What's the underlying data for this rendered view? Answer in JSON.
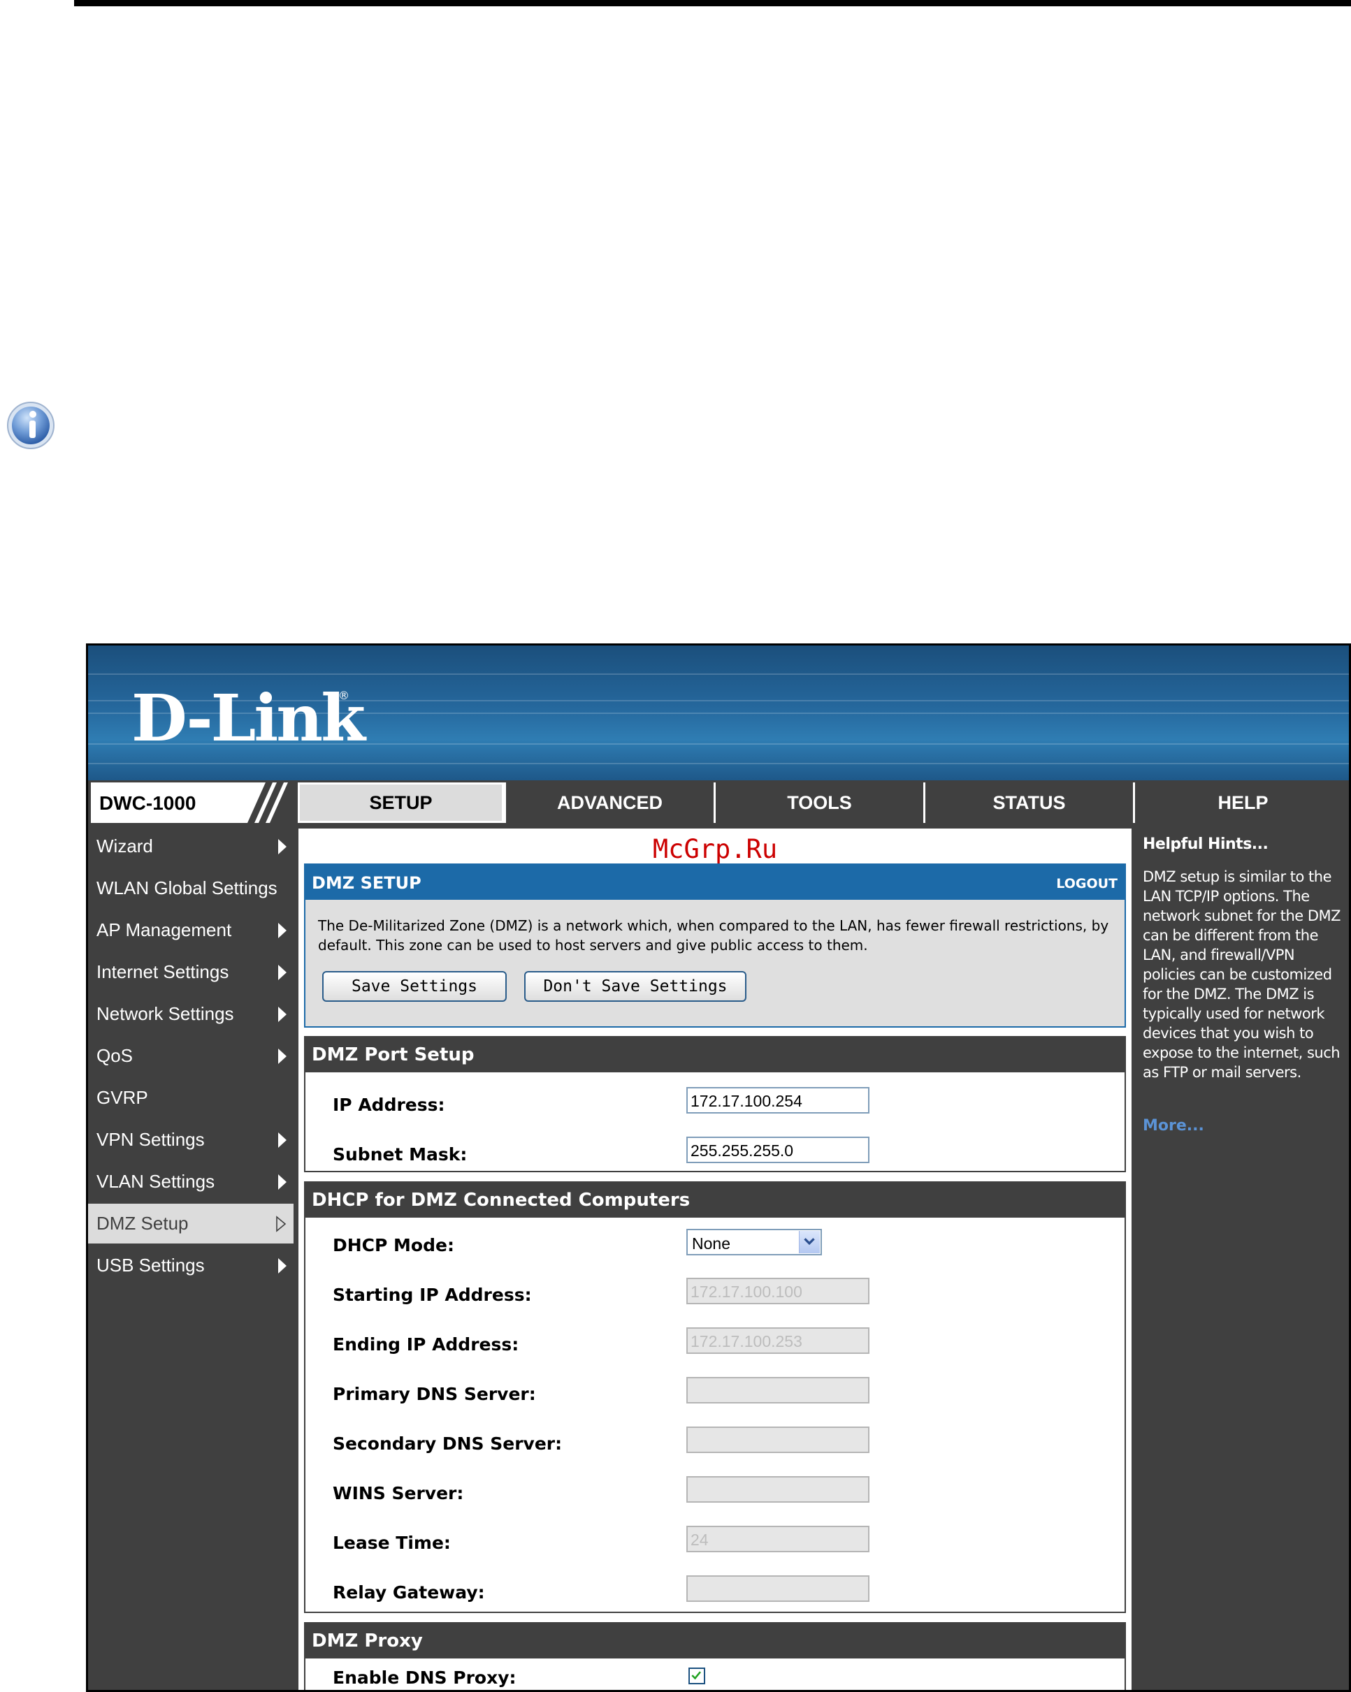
{
  "page": {
    "accent_color": "#1c6aa8",
    "dark_color": "#404040"
  },
  "brand": {
    "logo_text": "D-Link",
    "logo_mark": "®",
    "model": "DWC-1000"
  },
  "tabs": [
    {
      "label": "SETUP",
      "active": true
    },
    {
      "label": "ADVANCED",
      "active": false
    },
    {
      "label": "TOOLS",
      "active": false
    },
    {
      "label": "STATUS",
      "active": false
    },
    {
      "label": "HELP",
      "active": false
    }
  ],
  "sidebar": {
    "items": [
      {
        "label": "Wizard",
        "arrow": "submenu"
      },
      {
        "label": "WLAN Global Settings",
        "arrow": "none"
      },
      {
        "label": "AP Management",
        "arrow": "submenu"
      },
      {
        "label": "Internet Settings",
        "arrow": "submenu"
      },
      {
        "label": "Network Settings",
        "arrow": "submenu"
      },
      {
        "label": "QoS",
        "arrow": "submenu"
      },
      {
        "label": "GVRP",
        "arrow": "none"
      },
      {
        "label": "VPN Settings",
        "arrow": "submenu"
      },
      {
        "label": "VLAN Settings",
        "arrow": "submenu"
      },
      {
        "label": "DMZ Setup",
        "arrow": "active"
      },
      {
        "label": "USB Settings",
        "arrow": "submenu"
      }
    ]
  },
  "watermark": "McGrp.Ru",
  "dmz_setup": {
    "title": "DMZ SETUP",
    "logout": "LOGOUT",
    "description": "The De-Militarized Zone (DMZ) is a network which, when compared to the LAN, has fewer firewall restrictions, by default. This zone can be used to host servers and give public access to them.",
    "save_label": "Save Settings",
    "dont_save_label": "Don't Save Settings"
  },
  "port_setup": {
    "title": "DMZ Port Setup",
    "ip_label": "IP Address:",
    "ip_value": "172.17.100.254",
    "mask_label": "Subnet Mask:",
    "mask_value": "255.255.255.0"
  },
  "dhcp": {
    "title": "DHCP for DMZ Connected Computers",
    "mode_label": "DHCP Mode:",
    "mode_value": "None",
    "start_label": "Starting IP Address:",
    "start_value": "172.17.100.100",
    "end_label": "Ending IP Address:",
    "end_value": "172.17.100.253",
    "dns1_label": "Primary DNS Server:",
    "dns1_value": "",
    "dns2_label": "Secondary DNS Server:",
    "dns2_value": "",
    "wins_label": "WINS Server:",
    "wins_value": "",
    "lease_label": "Lease Time:",
    "lease_value": "24",
    "relay_label": "Relay Gateway:",
    "relay_value": ""
  },
  "proxy": {
    "title": "DMZ Proxy",
    "dns_proxy_label": "Enable DNS Proxy:",
    "dns_proxy_checked": true
  },
  "hints": {
    "title": "Helpful Hints...",
    "body": "DMZ setup is similar to the LAN TCP/IP options. The network subnet for the DMZ can be different from the LAN, and firewall/VPN policies can be customized for the DMZ. The DMZ is typically used for network devices that you wish to expose to the internet, such as FTP or mail servers.",
    "more": "More..."
  },
  "icons": {
    "info": "info-icon",
    "submenu_arrow": "triangle-right-icon",
    "active_arrow": "triangle-right-outline-icon",
    "dropdown": "chevron-down-icon",
    "check": "checkmark-icon"
  }
}
